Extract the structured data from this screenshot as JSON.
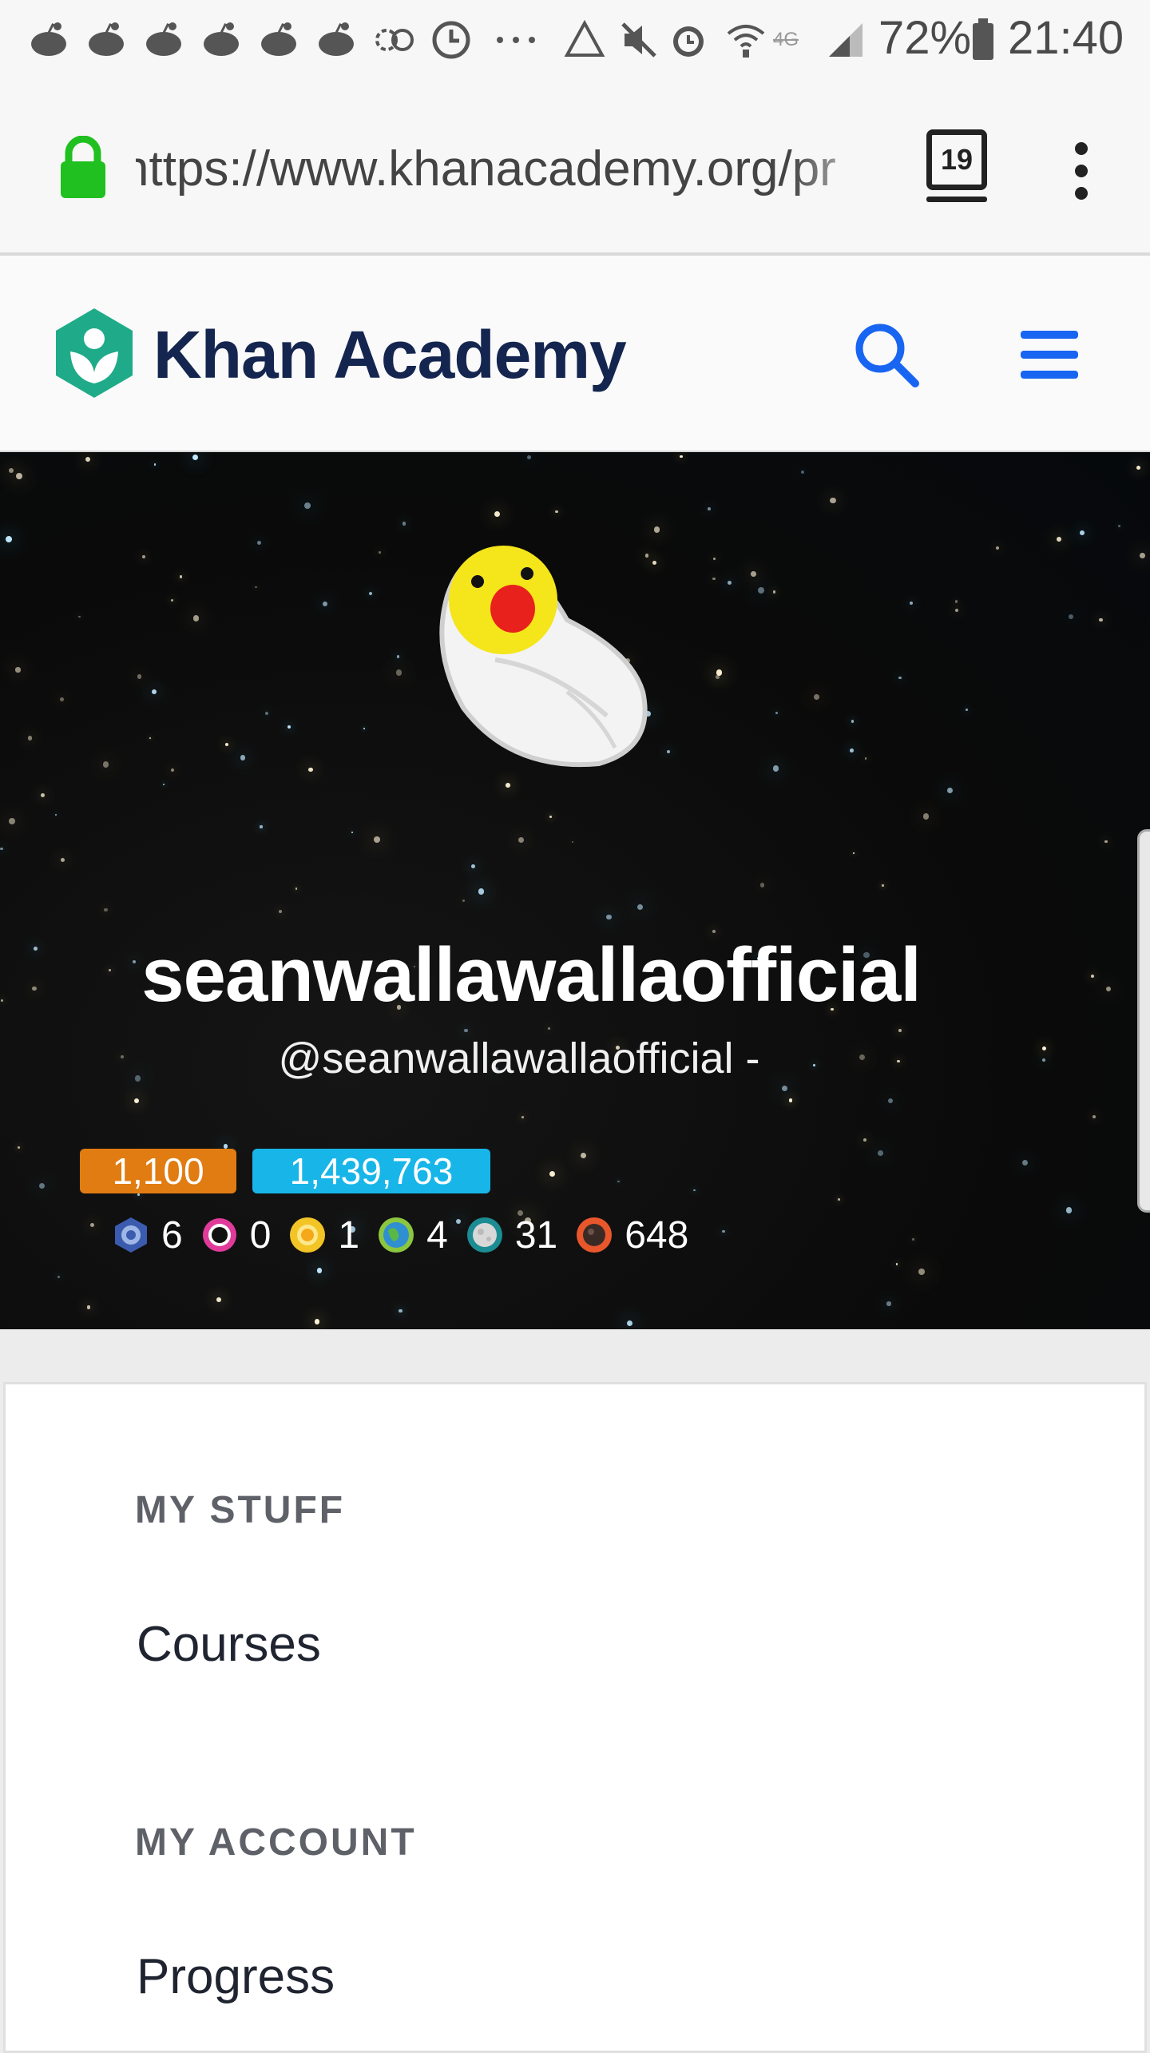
{
  "status_bar": {
    "battery": "72%",
    "time": "21:40",
    "network": "4G"
  },
  "browser": {
    "url": "https://www.khanacademy.org/pr",
    "tab_count": "19"
  },
  "header": {
    "brand": "Khan Academy",
    "colors": {
      "brand_text": "#14254f",
      "logo": "#1fab89",
      "accent": "#1865f2"
    }
  },
  "profile": {
    "display_name": "seanwallawallaofficial",
    "handle": "@seanwallawallaofficial -",
    "energy_points_level": "1,100",
    "energy_points": "1,439,763",
    "badges": [
      {
        "icon": "black-hole-badge-icon",
        "count": "6"
      },
      {
        "icon": "sun-badge-icon",
        "count": "0"
      },
      {
        "icon": "sun-badge-icon",
        "count": "1"
      },
      {
        "icon": "earth-badge-icon",
        "count": "4"
      },
      {
        "icon": "moon-badge-icon",
        "count": "31"
      },
      {
        "icon": "meteorite-badge-icon",
        "count": "648"
      }
    ]
  },
  "menu": {
    "my_stuff_heading": "MY STUFF",
    "courses": "Courses",
    "my_account_heading": "MY ACCOUNT",
    "progress": "Progress"
  }
}
